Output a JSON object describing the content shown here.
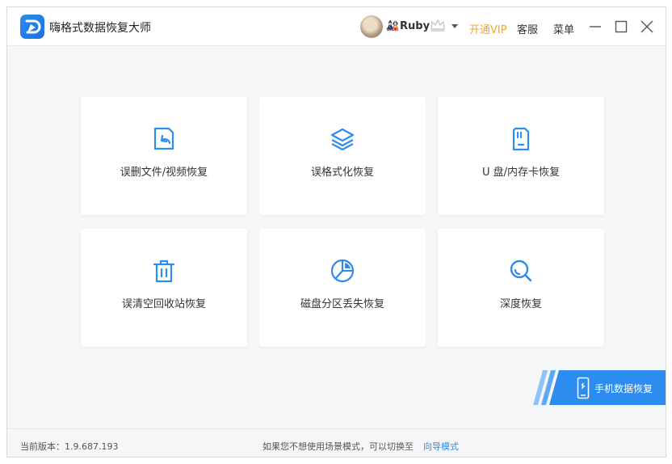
{
  "app": {
    "title": "嗨格式数据恢复大师",
    "logo_icon": "app-logo-icon"
  },
  "header": {
    "user_name": "Ruby",
    "user_glyph": "🎎",
    "vip_label": "开通VIP",
    "service_label": "客服",
    "menu_label": "菜单",
    "icons": [
      "avatar",
      "crown-icon",
      "chevron-down-icon",
      "minimize-icon",
      "maximize-icon",
      "close-icon"
    ]
  },
  "cards": [
    {
      "label": "误删文件/视频恢复",
      "icon": "file-restore-icon"
    },
    {
      "label": "误格式化恢复",
      "icon": "layers-icon"
    },
    {
      "label": "U 盘/内存卡恢复",
      "icon": "sd-card-icon"
    },
    {
      "label": "误清空回收站恢复",
      "icon": "trash-icon"
    },
    {
      "label": "磁盘分区丢失恢复",
      "icon": "pie-chart-icon"
    },
    {
      "label": "深度恢复",
      "icon": "magnifier-icon"
    }
  ],
  "phone": {
    "label": "手机数据恢复",
    "icon": "phone-icon"
  },
  "footer": {
    "version_label": "当前版本：1.9.687.193",
    "hint": "如果您不想使用场景模式，可以切换至",
    "guide_link": "向导模式"
  },
  "colors": {
    "accent": "#2d8cf0",
    "vip": "#f5a623",
    "background": "#f5f6f8",
    "card": "#ffffff"
  }
}
